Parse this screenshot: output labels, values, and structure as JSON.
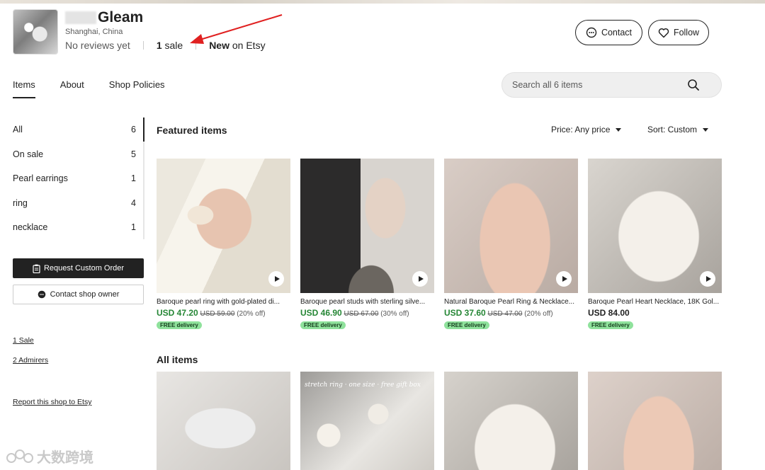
{
  "shop": {
    "name": "Gleam",
    "location": "Shanghai, China",
    "reviews": "No reviews yet",
    "sales_count": "1",
    "sales_label": "sale",
    "new_label": "New",
    "on_etsy": "on Etsy",
    "contact_label": "Contact",
    "follow_label": "Follow"
  },
  "tabs": [
    "Items",
    "About",
    "Shop Policies"
  ],
  "search": {
    "placeholder": "Search all 6 items"
  },
  "sidebar": {
    "items": [
      {
        "label": "All",
        "count": "6"
      },
      {
        "label": "On sale",
        "count": "5"
      },
      {
        "label": "Pearl earrings",
        "count": "1"
      },
      {
        "label": "ring",
        "count": "4"
      },
      {
        "label": "necklace",
        "count": "1"
      }
    ],
    "request_custom_order": "Request Custom Order",
    "contact_owner": "Contact shop owner",
    "sales_link": "1 Sale",
    "admirers_link": "2 Admirers",
    "report_link": "Report this shop to Etsy"
  },
  "featured": {
    "title": "Featured items",
    "price_filter": "Price: Any price",
    "sort_filter": "Sort: Custom",
    "items": [
      {
        "title": "Baroque pearl ring with gold-plated di...",
        "price": "USD 47.20",
        "original": "USD 59.00",
        "discount": "(20% off)",
        "badge": "FREE delivery"
      },
      {
        "title": "Baroque pearl studs with sterling silve...",
        "price": "USD 46.90",
        "original": "USD 67.00",
        "discount": "(30% off)",
        "badge": "FREE delivery"
      },
      {
        "title": "Natural Baroque Pearl Ring & Necklace...",
        "price": "USD 37.60",
        "original": "USD 47.00",
        "discount": "(20% off)",
        "badge": "FREE delivery"
      },
      {
        "title": "Baroque Pearl Heart Necklace, 18K Gol...",
        "price": "USD 84.00",
        "original": "",
        "discount": "",
        "badge": "FREE delivery"
      }
    ]
  },
  "all_items": {
    "title": "All items",
    "caption": "stretch ring · one size · free gift box"
  },
  "watermark": "大数跨境"
}
